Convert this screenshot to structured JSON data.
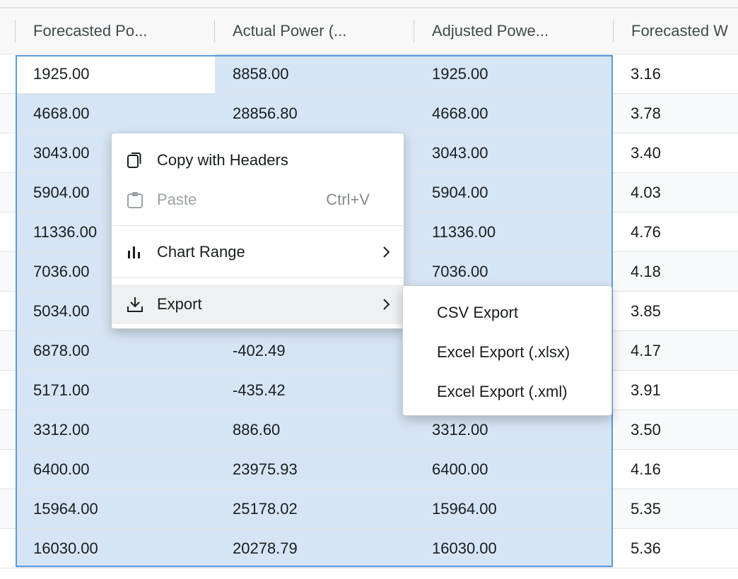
{
  "columns": [
    {
      "label": "Forecasted Po..."
    },
    {
      "label": "Actual Power (..."
    },
    {
      "label": "Adjusted Powe..."
    },
    {
      "label": "Forecasted W"
    }
  ],
  "rows": [
    [
      "1925.00",
      "8858.00",
      "1925.00",
      "3.16"
    ],
    [
      "4668.00",
      "28856.80",
      "4668.00",
      "3.78"
    ],
    [
      "3043.00",
      "",
      "3043.00",
      "3.40"
    ],
    [
      "5904.00",
      "",
      "5904.00",
      "4.03"
    ],
    [
      "11336.00",
      "",
      "11336.00",
      "4.76"
    ],
    [
      "7036.00",
      "",
      "7036.00",
      "4.18"
    ],
    [
      "5034.00",
      "",
      "",
      "3.85"
    ],
    [
      "6878.00",
      "-402.49",
      "",
      "4.17"
    ],
    [
      "5171.00",
      "-435.42",
      "",
      "3.91"
    ],
    [
      "3312.00",
      "886.60",
      "3312.00",
      "3.50"
    ],
    [
      "6400.00",
      "23975.93",
      "6400.00",
      "4.16"
    ],
    [
      "15964.00",
      "25178.02",
      "15964.00",
      "5.35"
    ],
    [
      "16030.00",
      "20278.79",
      "16030.00",
      "5.36"
    ]
  ],
  "context_menu": {
    "copy_with_headers": "Copy with Headers",
    "paste": "Paste",
    "paste_shortcut": "Ctrl+V",
    "chart_range": "Chart Range",
    "export": "Export"
  },
  "export_submenu": {
    "csv": "CSV Export",
    "xlsx": "Excel Export (.xlsx)",
    "xml": "Excel Export (.xml)"
  },
  "colors": {
    "selection": "#d6e5f6",
    "range_border": "#5a9bd8",
    "header_bg": "#f8f8f8"
  }
}
